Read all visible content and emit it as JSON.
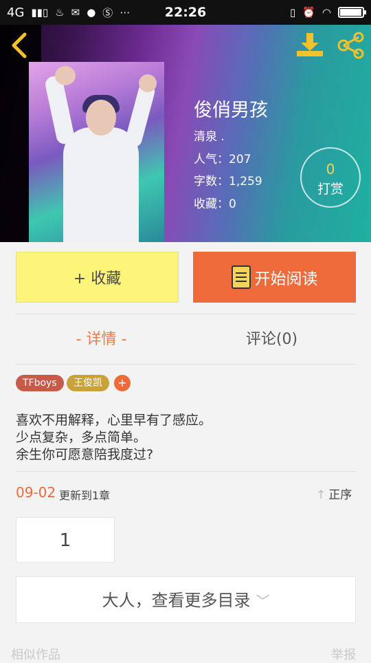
{
  "statusbar": {
    "network": "4G",
    "time": "22:26",
    "battery_level": 0.92
  },
  "header": {
    "back_icon": "chevron-left-icon",
    "download_icon": "download-icon",
    "share_icon": "share-icon",
    "accent_color": "#f3c22a"
  },
  "book": {
    "title": "俊俏男孩",
    "author": "清泉 .",
    "popularity": "人气：207",
    "word_count": "字数：1,259",
    "favorites": "收藏：0",
    "tip_count": "0",
    "tip_label": "打赏"
  },
  "actions": {
    "favorite_label": "+ 收藏",
    "read_label": "开始阅读"
  },
  "tabs": {
    "detail": "- 详情 -",
    "comments": "评论(0)"
  },
  "tags": [
    {
      "label": "TFboys",
      "color": "#c85a4a"
    },
    {
      "label": "王俊凯",
      "color": "#c9a23a"
    }
  ],
  "tag_add": "+",
  "description": [
    "喜欢不用解释，心里早有了感应。",
    "少点复杂，多点简单。",
    "余生你可愿意陪我度过?"
  ],
  "update": {
    "date": "09-02",
    "text": "更新到1章",
    "sort_label": "正序"
  },
  "chapters": {
    "first": "1",
    "more_label": "大人，查看更多目录"
  },
  "footer": {
    "similar": "相似作品",
    "report": "举报"
  },
  "colors": {
    "orange": "#ee6a3a",
    "yellow": "#fcf57a"
  }
}
